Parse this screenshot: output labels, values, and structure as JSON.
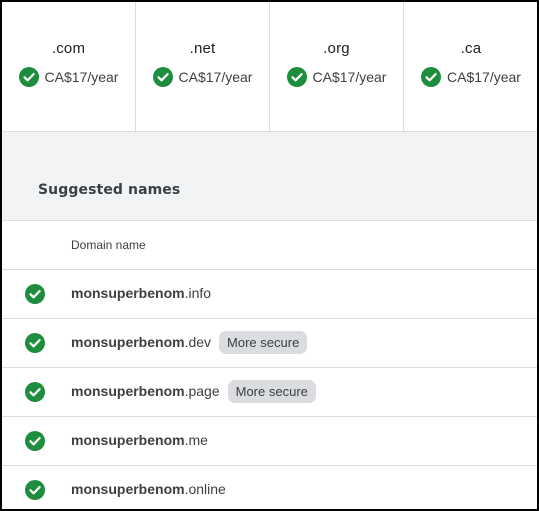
{
  "tlds": [
    {
      "name": ".com",
      "price": "CA$17/year"
    },
    {
      "name": ".net",
      "price": "CA$17/year"
    },
    {
      "name": ".org",
      "price": "CA$17/year"
    },
    {
      "name": ".ca",
      "price": "CA$17/year"
    }
  ],
  "suggested": {
    "title": "Suggested names",
    "column_header": "Domain name",
    "rows": [
      {
        "base": "monsuperbenom",
        "ext": ".info",
        "badge": ""
      },
      {
        "base": "monsuperbenom",
        "ext": ".dev",
        "badge": "More secure"
      },
      {
        "base": "monsuperbenom",
        "ext": ".page",
        "badge": "More secure"
      },
      {
        "base": "monsuperbenom",
        "ext": ".me",
        "badge": ""
      },
      {
        "base": "monsuperbenom",
        "ext": ".online",
        "badge": ""
      }
    ]
  },
  "icons": {
    "available": "check-circle-icon"
  },
  "colors": {
    "available_green": "#1e8e3e",
    "chip_bg": "#dadce0",
    "band_bg": "#f1f3f4"
  }
}
